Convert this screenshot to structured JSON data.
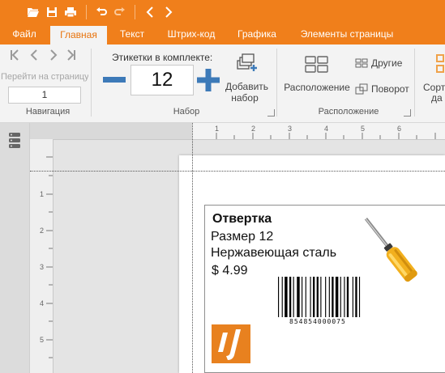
{
  "ribbon_tabs": [
    "Файл",
    "Главная",
    "Текст",
    "Штрих-код",
    "Графика",
    "Элементы страницы"
  ],
  "active_tab": "Главная",
  "navigation": {
    "goto_label": "Перейти на страницу",
    "page_value": "1",
    "group_label": "Навигация"
  },
  "set": {
    "labels_in_set_label": "Этикетки в комплекте:",
    "count_value": "12",
    "add_set_label_line1": "Добавить",
    "add_set_label_line2": "набор",
    "group_label": "Набор"
  },
  "layout": {
    "layout_label": "Расположение",
    "others_label": "Другие",
    "rotate_label": "Поворот",
    "group_label": "Расположение",
    "sort_label_partial_1": "Сорт",
    "sort_label_partial_2": "да"
  },
  "ruler": {
    "h_ticks": [
      "1",
      "2",
      "3",
      "4",
      "5",
      "6"
    ],
    "v_ticks": [
      "1",
      "2",
      "3",
      "4",
      "5"
    ]
  },
  "label": {
    "title": "Отвертка",
    "line2": "Размер 12",
    "line3": "Нержавеющая сталь",
    "price": "$ 4.99",
    "barcode_number": "854854000075"
  },
  "colors": {
    "brand": "#f07f1b",
    "ribbon_bg": "#f3f3f3",
    "accent_blue": "#3d7ab8"
  }
}
